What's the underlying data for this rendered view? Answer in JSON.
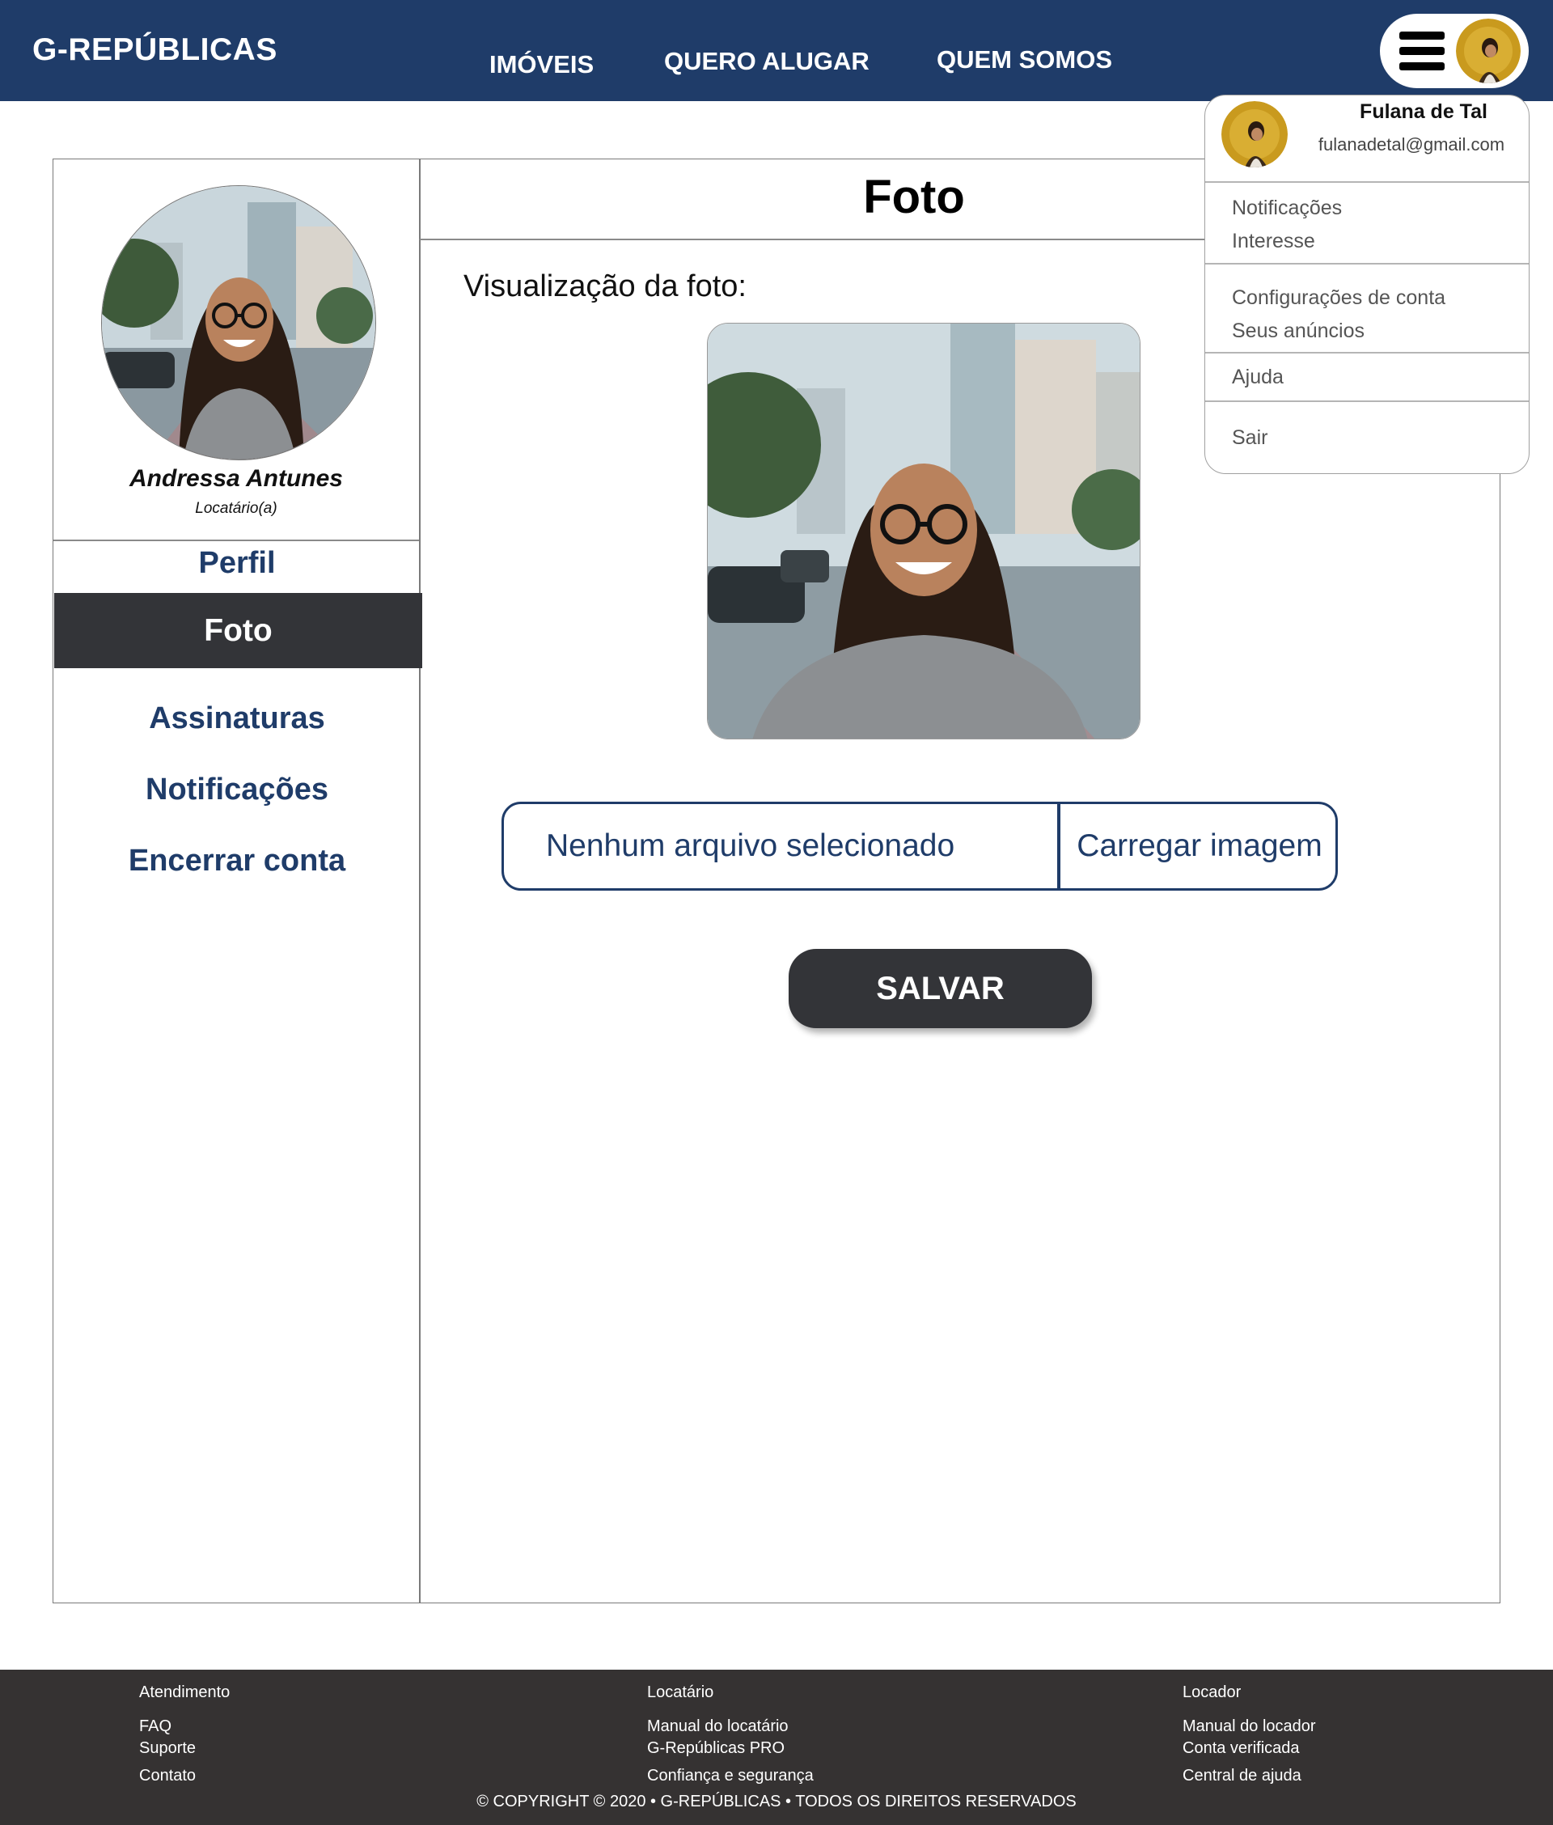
{
  "header": {
    "logo": "G-REPÚBLICAS",
    "nav": [
      "IMÓVEIS",
      "QUERO ALUGAR",
      "QUEM SOMOS"
    ]
  },
  "colors": {
    "brand": "#1f3c69",
    "dark": "#333438",
    "footer": "#353232"
  },
  "user_menu": {
    "name": "Fulana de Tal",
    "email": "fulanadetal@gmail.com",
    "items": [
      "Notificações",
      "Interesse",
      "Configurações de conta",
      "Seus anúncios",
      "Ajuda",
      "Sair"
    ]
  },
  "sidebar": {
    "name": "Andressa Antunes",
    "role": "Locatário(a)",
    "items": [
      "Perfil",
      "Foto",
      "Assinaturas",
      "Notificações",
      "Encerrar conta"
    ],
    "active": "Foto"
  },
  "main": {
    "title": "Foto",
    "preview_label": "Visualização da foto:",
    "file_status": "Nenhum arquivo selecionado",
    "upload_label": "Carregar imagem",
    "save_label": "SALVAR"
  },
  "footer": {
    "columns": [
      {
        "heading": "Atendimento",
        "links": [
          "FAQ",
          "Suporte",
          "Contato"
        ]
      },
      {
        "heading": "Locatário",
        "links": [
          "Manual do locatário",
          "G-Repúblicas PRO",
          "Confiança e segurança"
        ]
      },
      {
        "heading": "Locador",
        "links": [
          "Manual do locador",
          "Conta verificada",
          "Central de ajuda"
        ]
      }
    ],
    "copyright": "© COPYRIGHT © 2020 • G-REPÚBLICAS • TODOS OS DIREITOS RESERVADOS"
  }
}
